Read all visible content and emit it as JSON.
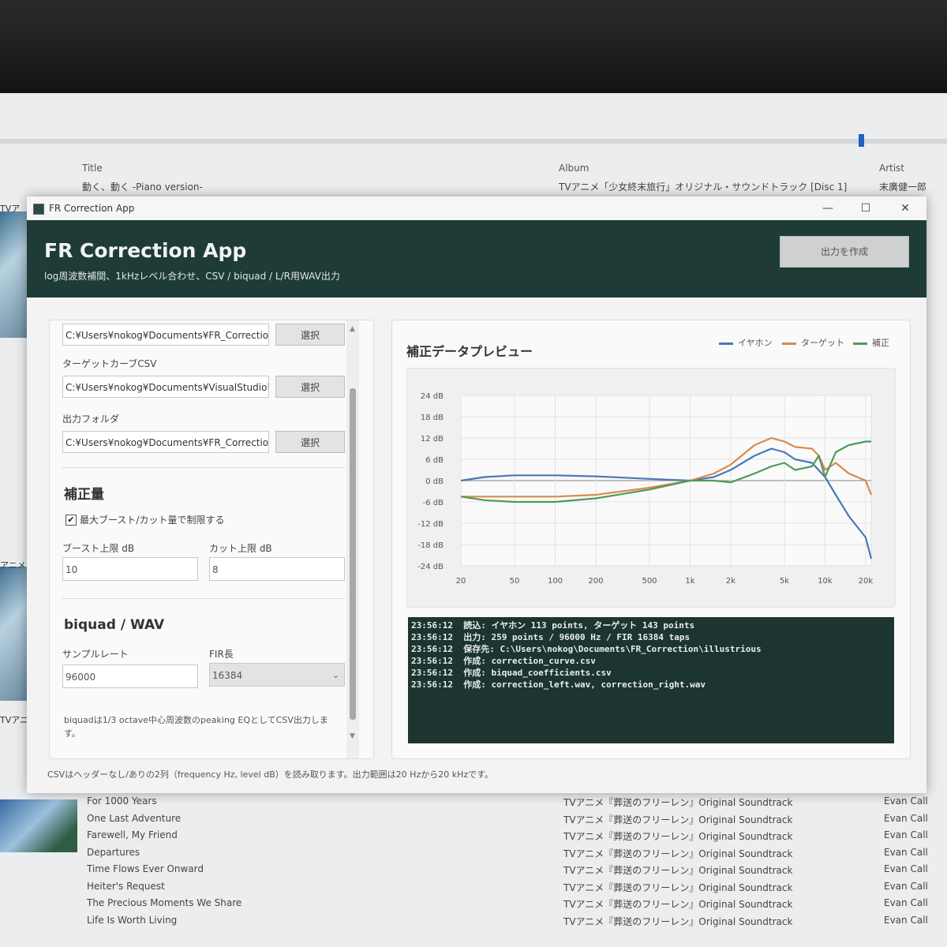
{
  "background": {
    "columns": {
      "title": "Title",
      "album": "Album",
      "artist": "Artist"
    },
    "now_playing": {
      "title": "動く、動く -Piano version-",
      "album": "TVアニメ「少女終末旅行」オリジナル・サウンドトラック [Disc 1]",
      "artist": "末廣健一郎"
    },
    "left_labels": [
      "TVア",
      "アニメ",
      "TVアニ"
    ],
    "tracks": [
      {
        "title": "For 1000 Years",
        "album": "TVアニメ『葬送のフリーレン』Original Soundtrack",
        "artist": "Evan Call"
      },
      {
        "title": "One Last Adventure",
        "album": "TVアニメ『葬送のフリーレン』Original Soundtrack",
        "artist": "Evan Call"
      },
      {
        "title": "Farewell, My Friend",
        "album": "TVアニメ『葬送のフリーレン』Original Soundtrack",
        "artist": "Evan Call"
      },
      {
        "title": "Departures",
        "album": "TVアニメ『葬送のフリーレン』Original Soundtrack",
        "artist": "Evan Call"
      },
      {
        "title": "Time Flows Ever Onward",
        "album": "TVアニメ『葬送のフリーレン』Original Soundtrack",
        "artist": "Evan Call"
      },
      {
        "title": "Heiter's Request",
        "album": "TVアニメ『葬送のフリーレン』Original Soundtrack",
        "artist": "Evan Call"
      },
      {
        "title": "The Precious Moments We Share",
        "album": "TVアニメ『葬送のフリーレン』Original Soundtrack",
        "artist": "Evan Call"
      },
      {
        "title": "Life Is Worth Living",
        "album": "TVアニメ『葬送のフリーレン』Original Soundtrack",
        "artist": "Evan Call"
      }
    ]
  },
  "window": {
    "title": "FR Correction App",
    "controls": {
      "minimize": "—",
      "maximize": "☐",
      "close": "✕"
    }
  },
  "header": {
    "title": "FR Correction App",
    "subtitle": "log周波数補間、1kHzレベル合わせ、CSV / biquad / L/R用WAV出力",
    "generate_button": "出力を作成"
  },
  "settings": {
    "earphone_path": "C:¥Users¥nokog¥Documents¥FR_Correction¥i",
    "target_label": "ターゲットカーブCSV",
    "target_path": "C:¥Users¥nokog¥Documents¥VisualStudio¥FR",
    "output_label": "出力フォルダ",
    "output_path": "C:¥Users¥nokog¥Documents¥FR_Correction¥i",
    "select_button": "選択",
    "correction_section": "補正量",
    "limit_checkbox": "最大ブースト/カット量で制限する",
    "limit_checked": true,
    "boost_label": "ブースト上限 dB",
    "boost_value": "10",
    "cut_label": "カット上限 dB",
    "cut_value": "8",
    "biquad_section": "biquad / WAV",
    "samplerate_label": "サンプルレート",
    "samplerate_value": "96000",
    "fir_label": "FIR長",
    "fir_value": "16384",
    "hint": "biquadは1/3 octave中心周波数のpeaking EQとしてCSV出力します。"
  },
  "preview": {
    "title": "補正データプレビュー"
  },
  "chart_data": {
    "type": "line",
    "x_scale": "log",
    "xlim": [
      20,
      22000
    ],
    "ylim": [
      -24,
      24
    ],
    "x_ticks": [
      20,
      50,
      100,
      200,
      500,
      1000,
      2000,
      5000,
      10000,
      20000
    ],
    "x_tick_labels": [
      "20",
      "50",
      "100",
      "200",
      "500",
      "1k",
      "2k",
      "5k",
      "10k",
      "20k"
    ],
    "y_ticks": [
      24,
      18,
      12,
      6,
      0,
      -6,
      -12,
      -18,
      -24
    ],
    "y_tick_labels": [
      "24 dB",
      "18 dB",
      "12 dB",
      "6 dB",
      "0 dB",
      "-6 dB",
      "-12 dB",
      "-18 dB",
      "-24 dB"
    ],
    "grid": true,
    "legend_position": "top-right",
    "series": [
      {
        "name": "イヤホン",
        "color": "#4a78b8",
        "x": [
          20,
          30,
          50,
          100,
          200,
          500,
          1000,
          1500,
          2000,
          3000,
          4000,
          5000,
          6000,
          8000,
          10000,
          12000,
          15000,
          20000,
          22000
        ],
        "y": [
          0,
          1,
          1.5,
          1.5,
          1.2,
          0.5,
          0,
          1,
          3,
          7,
          9,
          8,
          6,
          5,
          1,
          -4,
          -10,
          -16,
          -22
        ]
      },
      {
        "name": "ターゲット",
        "color": "#d98a4a",
        "x": [
          20,
          30,
          50,
          100,
          200,
          500,
          1000,
          1500,
          2000,
          3000,
          4000,
          5000,
          6000,
          8000,
          9000,
          10000,
          12000,
          15000,
          20000,
          22000
        ],
        "y": [
          -4.5,
          -4.5,
          -4.5,
          -4.5,
          -4,
          -2,
          0,
          2,
          4.5,
          10,
          12,
          11,
          9.5,
          9,
          7,
          3,
          5,
          2,
          0,
          -4
        ]
      },
      {
        "name": "補正",
        "color": "#4e9a5a",
        "x": [
          20,
          30,
          50,
          100,
          200,
          500,
          1000,
          1500,
          2000,
          3000,
          4000,
          5000,
          6000,
          8000,
          9000,
          10000,
          12000,
          15000,
          20000,
          22000
        ],
        "y": [
          -4.5,
          -5.5,
          -6,
          -6,
          -5,
          -2.5,
          0,
          0,
          -0.5,
          2,
          4,
          5,
          3,
          4,
          7,
          1,
          8,
          10,
          11,
          11
        ]
      }
    ]
  },
  "log": {
    "lines": [
      "23:56:12  読込: イヤホン 113 points, ターゲット 143 points",
      "23:56:12  出力: 259 points / 96000 Hz / FIR 16384 taps",
      "23:56:12  保存先: C:\\Users\\nokog\\Documents\\FR_Correction\\illustrious",
      "23:56:12  作成: correction_curve.csv",
      "23:56:12  作成: biquad_coefficients.csv",
      "23:56:12  作成: correction_left.wav, correction_right.wav"
    ]
  },
  "footer": "CSVはヘッダーなし/ありの2列（frequency Hz, level dB）を読み取ります。出力範囲は20 Hzから20 kHzです。"
}
